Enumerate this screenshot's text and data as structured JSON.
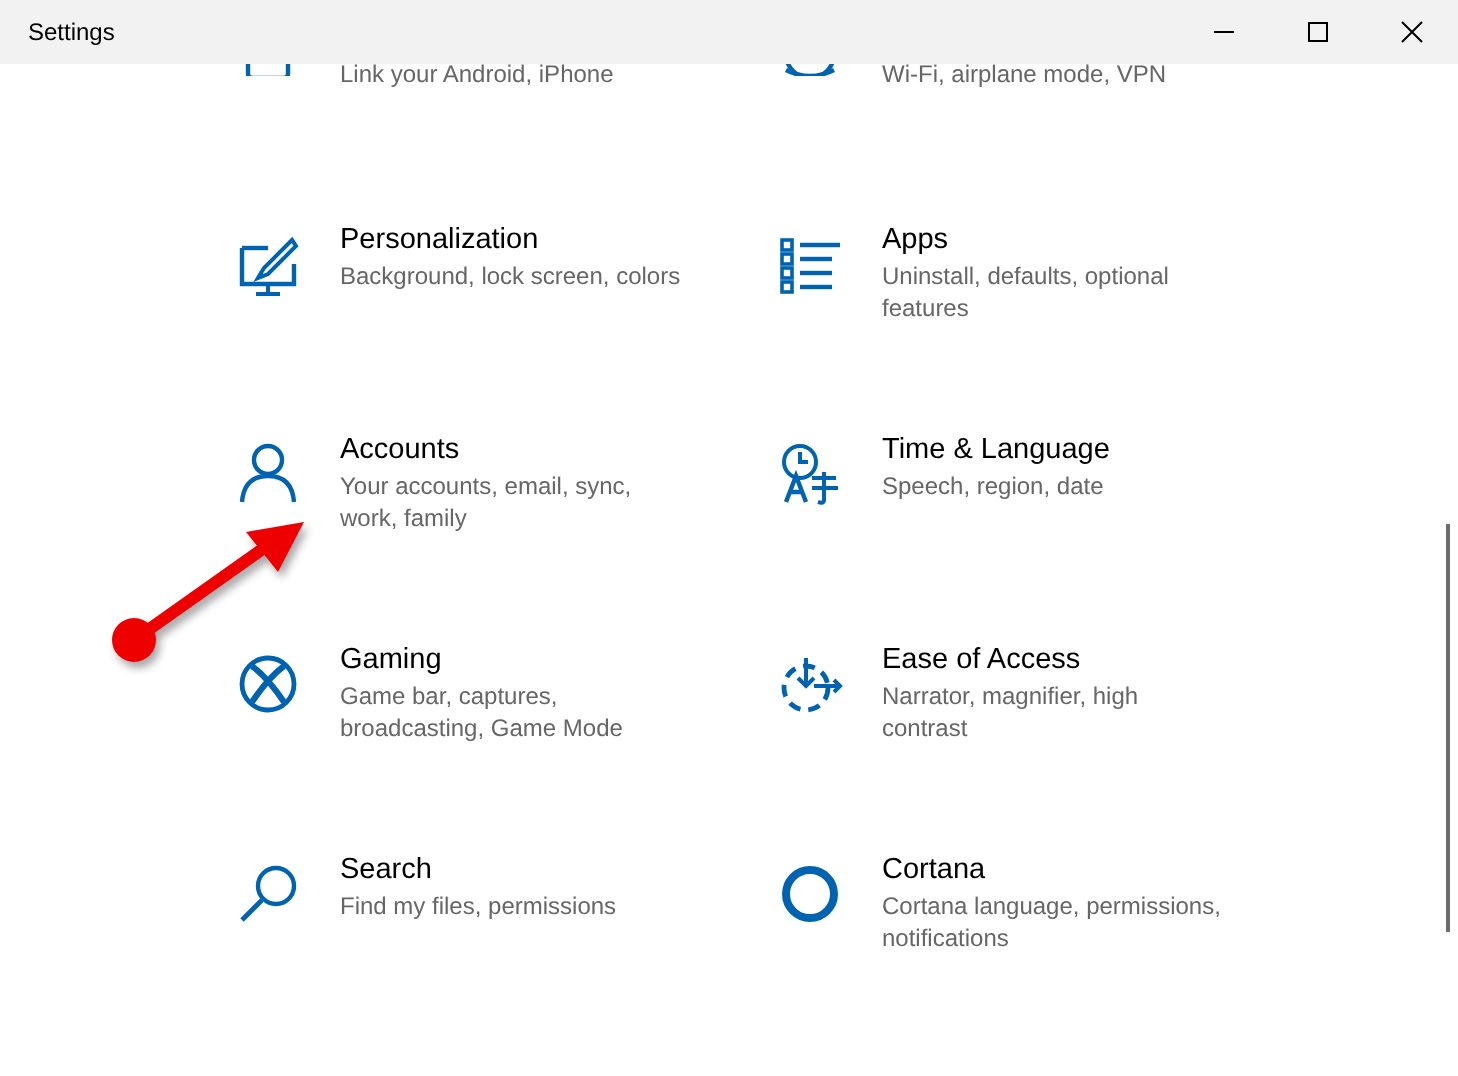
{
  "window": {
    "title": "Settings"
  },
  "categories": [
    {
      "description": "Link your Android, iPhone"
    },
    {
      "description": "Wi-Fi, airplane mode, VPN"
    },
    {
      "title": "Personalization",
      "description": "Background, lock screen, colors"
    },
    {
      "title": "Apps",
      "description": "Uninstall, defaults, optional features"
    },
    {
      "title": "Accounts",
      "description": "Your accounts, email, sync, work, family"
    },
    {
      "title": "Time & Language",
      "description": "Speech, region, date"
    },
    {
      "title": "Gaming",
      "description": "Game bar, captures, broadcasting, Game Mode"
    },
    {
      "title": "Ease of Access",
      "description": "Narrator, magnifier, high contrast"
    },
    {
      "title": "Search",
      "description": "Find my files, permissions"
    },
    {
      "title": "Cortana",
      "description": "Cortana language, permissions, notifications"
    }
  ]
}
